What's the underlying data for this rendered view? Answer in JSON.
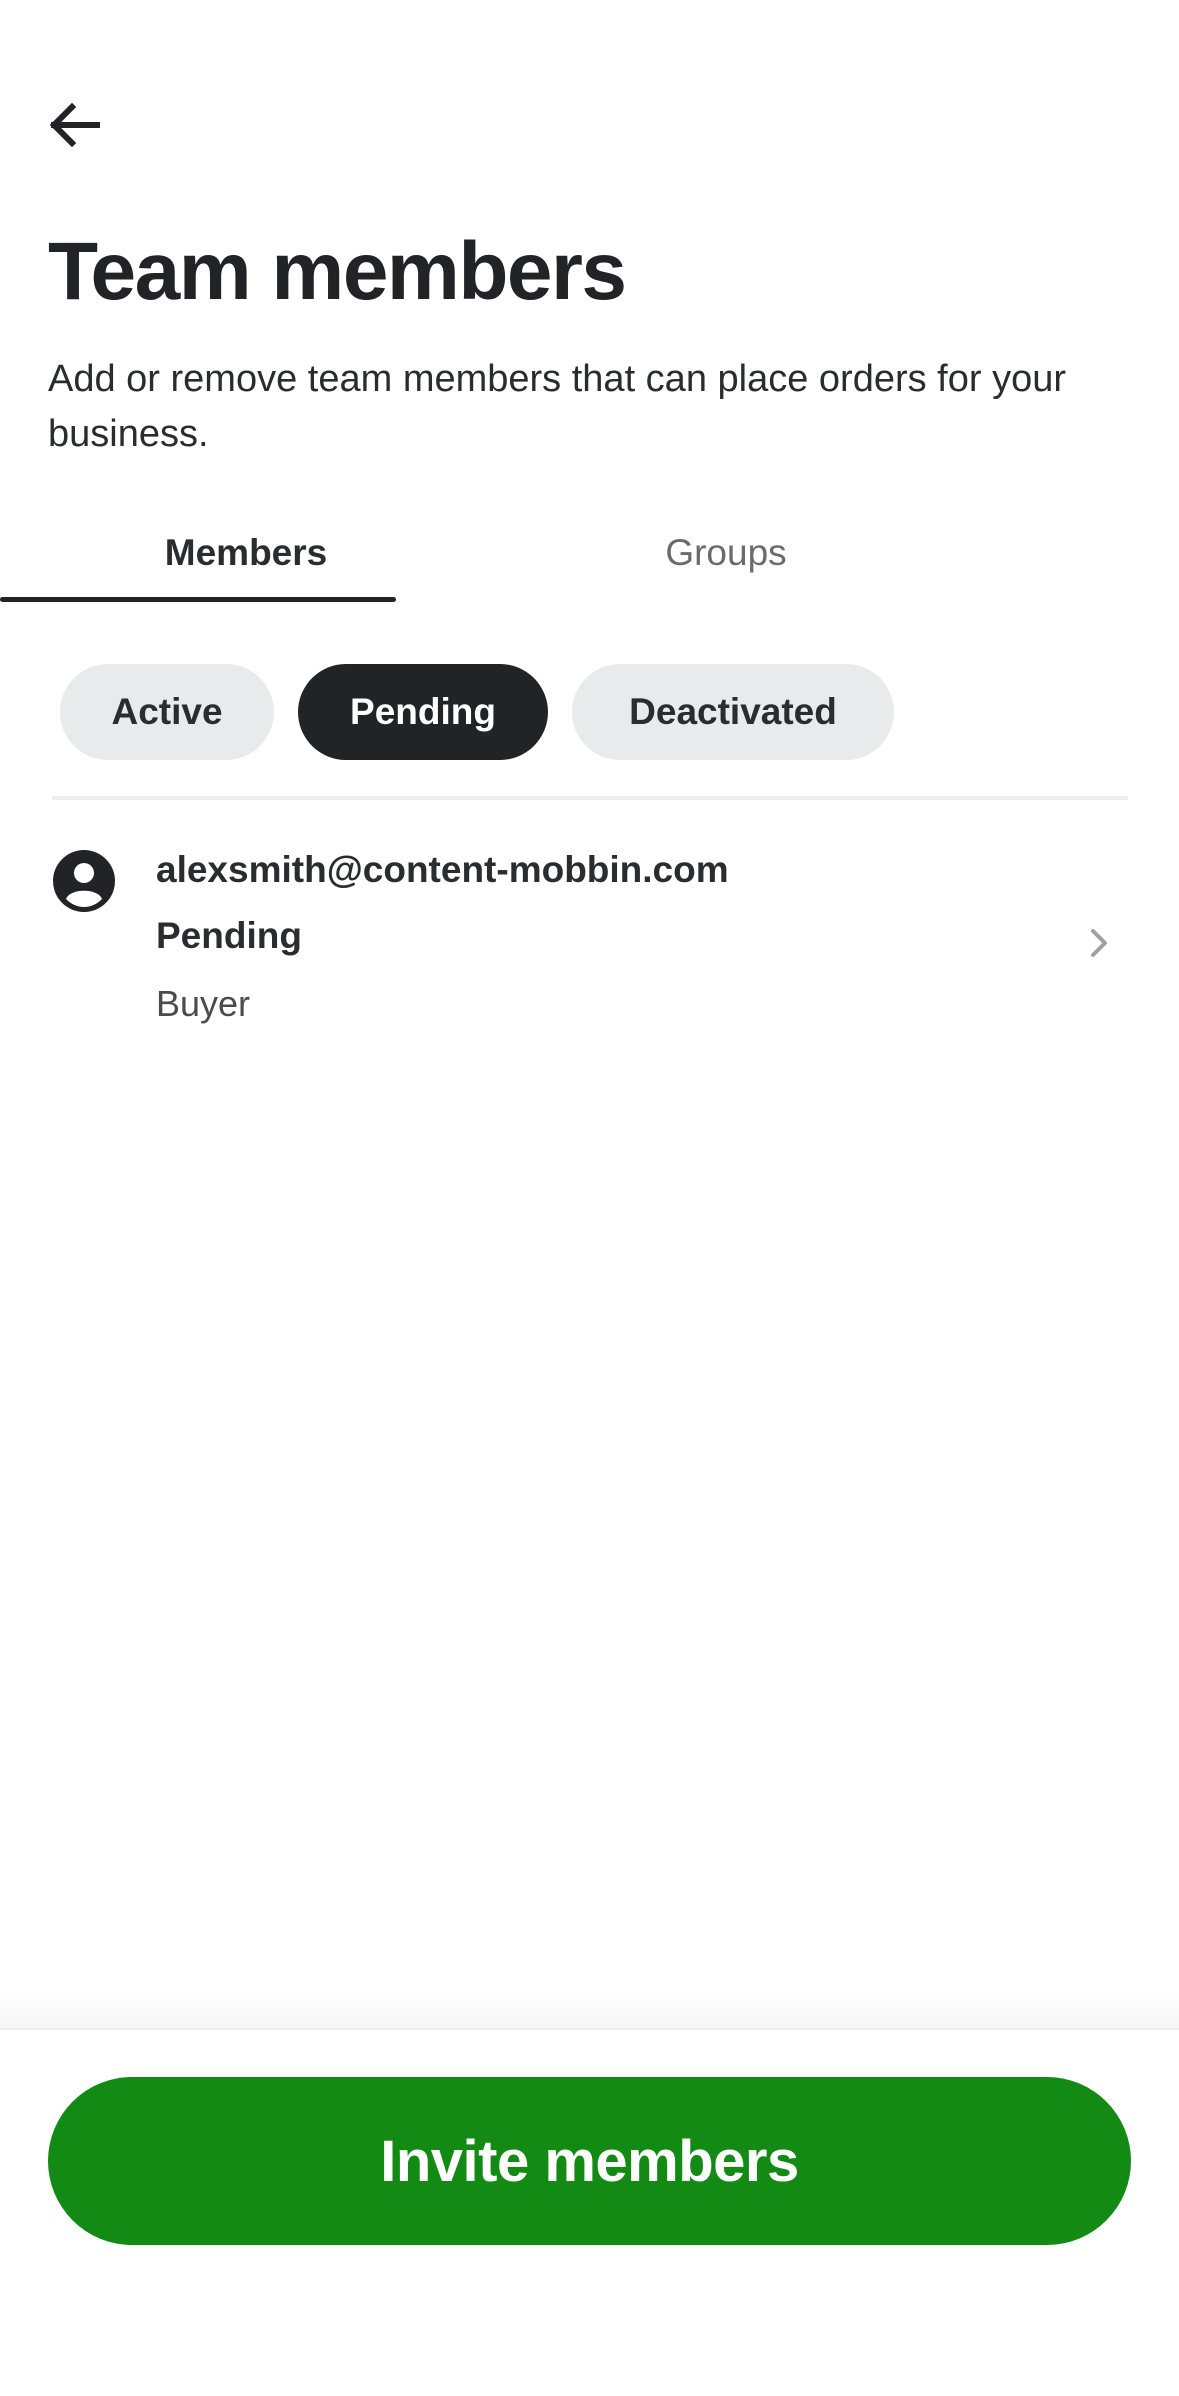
{
  "header": {
    "back_icon": "arrow-left-icon",
    "title": "Team members",
    "subtitle": "Add or remove team members that can place orders for your business."
  },
  "tabs": [
    {
      "label": "Members",
      "selected": true
    },
    {
      "label": "Groups",
      "selected": false
    }
  ],
  "filters": [
    {
      "label": "Active",
      "selected": false
    },
    {
      "label": "Pending",
      "selected": true
    },
    {
      "label": "Deactivated",
      "selected": false
    }
  ],
  "members": [
    {
      "avatar_icon": "user-circle-icon",
      "email": "alexsmith@content-mobbin.com",
      "status": "Pending",
      "role": "Buyer",
      "chevron_icon": "chevron-right-icon"
    }
  ],
  "footer": {
    "invite_label": "Invite members"
  },
  "colors": {
    "primary_text": "#222326",
    "chip_selected": "#222326",
    "chip_default": "#e9eaec",
    "invite_button": "#128a14"
  }
}
